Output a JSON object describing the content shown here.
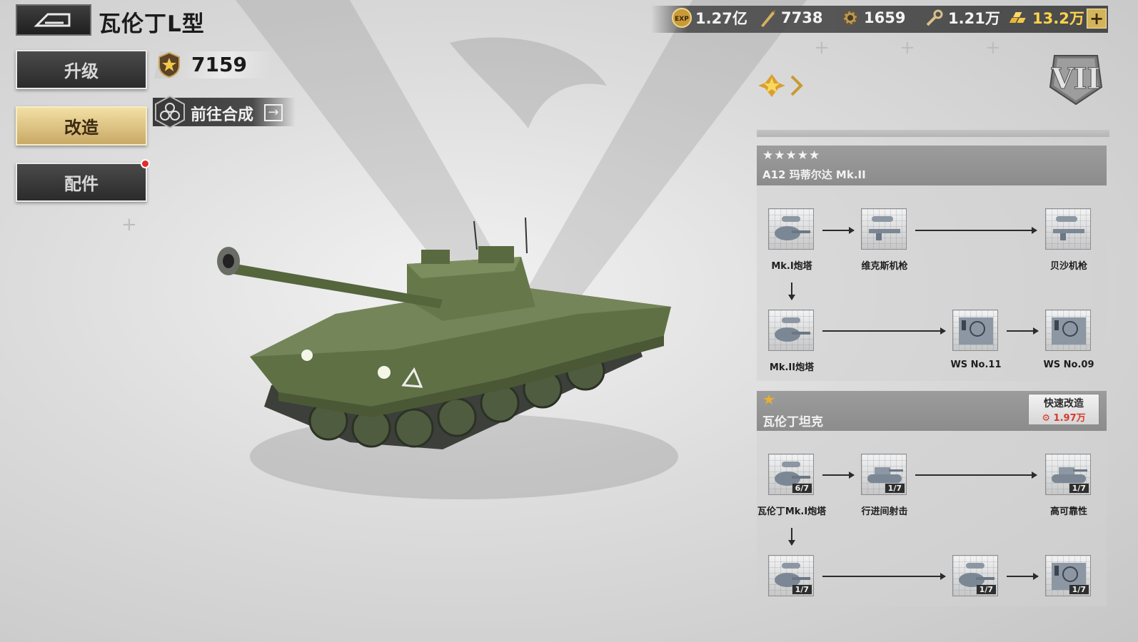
{
  "header": {
    "tank_name": "瓦伦丁L型"
  },
  "side_menu": {
    "upgrade": "升级",
    "modify": "改造",
    "parts": "配件",
    "active": "modify"
  },
  "power": {
    "value": "7159"
  },
  "synthesis": {
    "label": "前往合成"
  },
  "resources": {
    "exp": "1.27亿",
    "bullet": "7738",
    "gear": "1659",
    "wrench": "1.21万",
    "gold": "13.2万"
  },
  "tier": "VII",
  "panel1": {
    "stars": "★★★★★",
    "title": "A12 玛蒂尔达 Mk.II",
    "nodes": [
      {
        "label": "Mk.I炮塔",
        "icon": "turret-icon"
      },
      {
        "label": "维克斯机枪",
        "icon": "machine-gun-icon"
      },
      {
        "label": "贝沙机枪",
        "icon": "machine-gun-icon"
      },
      {
        "label": "Mk.II炮塔",
        "icon": "turret-icon"
      },
      {
        "label": "WS No.11",
        "icon": "radio-icon"
      },
      {
        "label": "WS No.09",
        "icon": "radio-icon"
      }
    ]
  },
  "panel2": {
    "title": "瓦伦丁坦克",
    "quick_modify": "快速改造",
    "quick_cost": "1.97万",
    "nodes": [
      {
        "label": "瓦伦丁Mk.I炮塔",
        "count": "6/7",
        "icon": "turret-icon"
      },
      {
        "label": "行进间射击",
        "count": "1/7",
        "icon": "tank-icon"
      },
      {
        "label": "高可靠性",
        "count": "1/7",
        "icon": "tank-icon"
      },
      {
        "label": "",
        "count": "1/7",
        "icon": "turret-icon"
      },
      {
        "label": "",
        "count": "1/7",
        "icon": "turret-icon"
      },
      {
        "label": "",
        "count": "1/7",
        "icon": "radio-icon"
      }
    ]
  },
  "colors": {
    "accent_gold": "#d4b45a",
    "dark_button": "#333333",
    "alert_red": "#e52a2a"
  }
}
